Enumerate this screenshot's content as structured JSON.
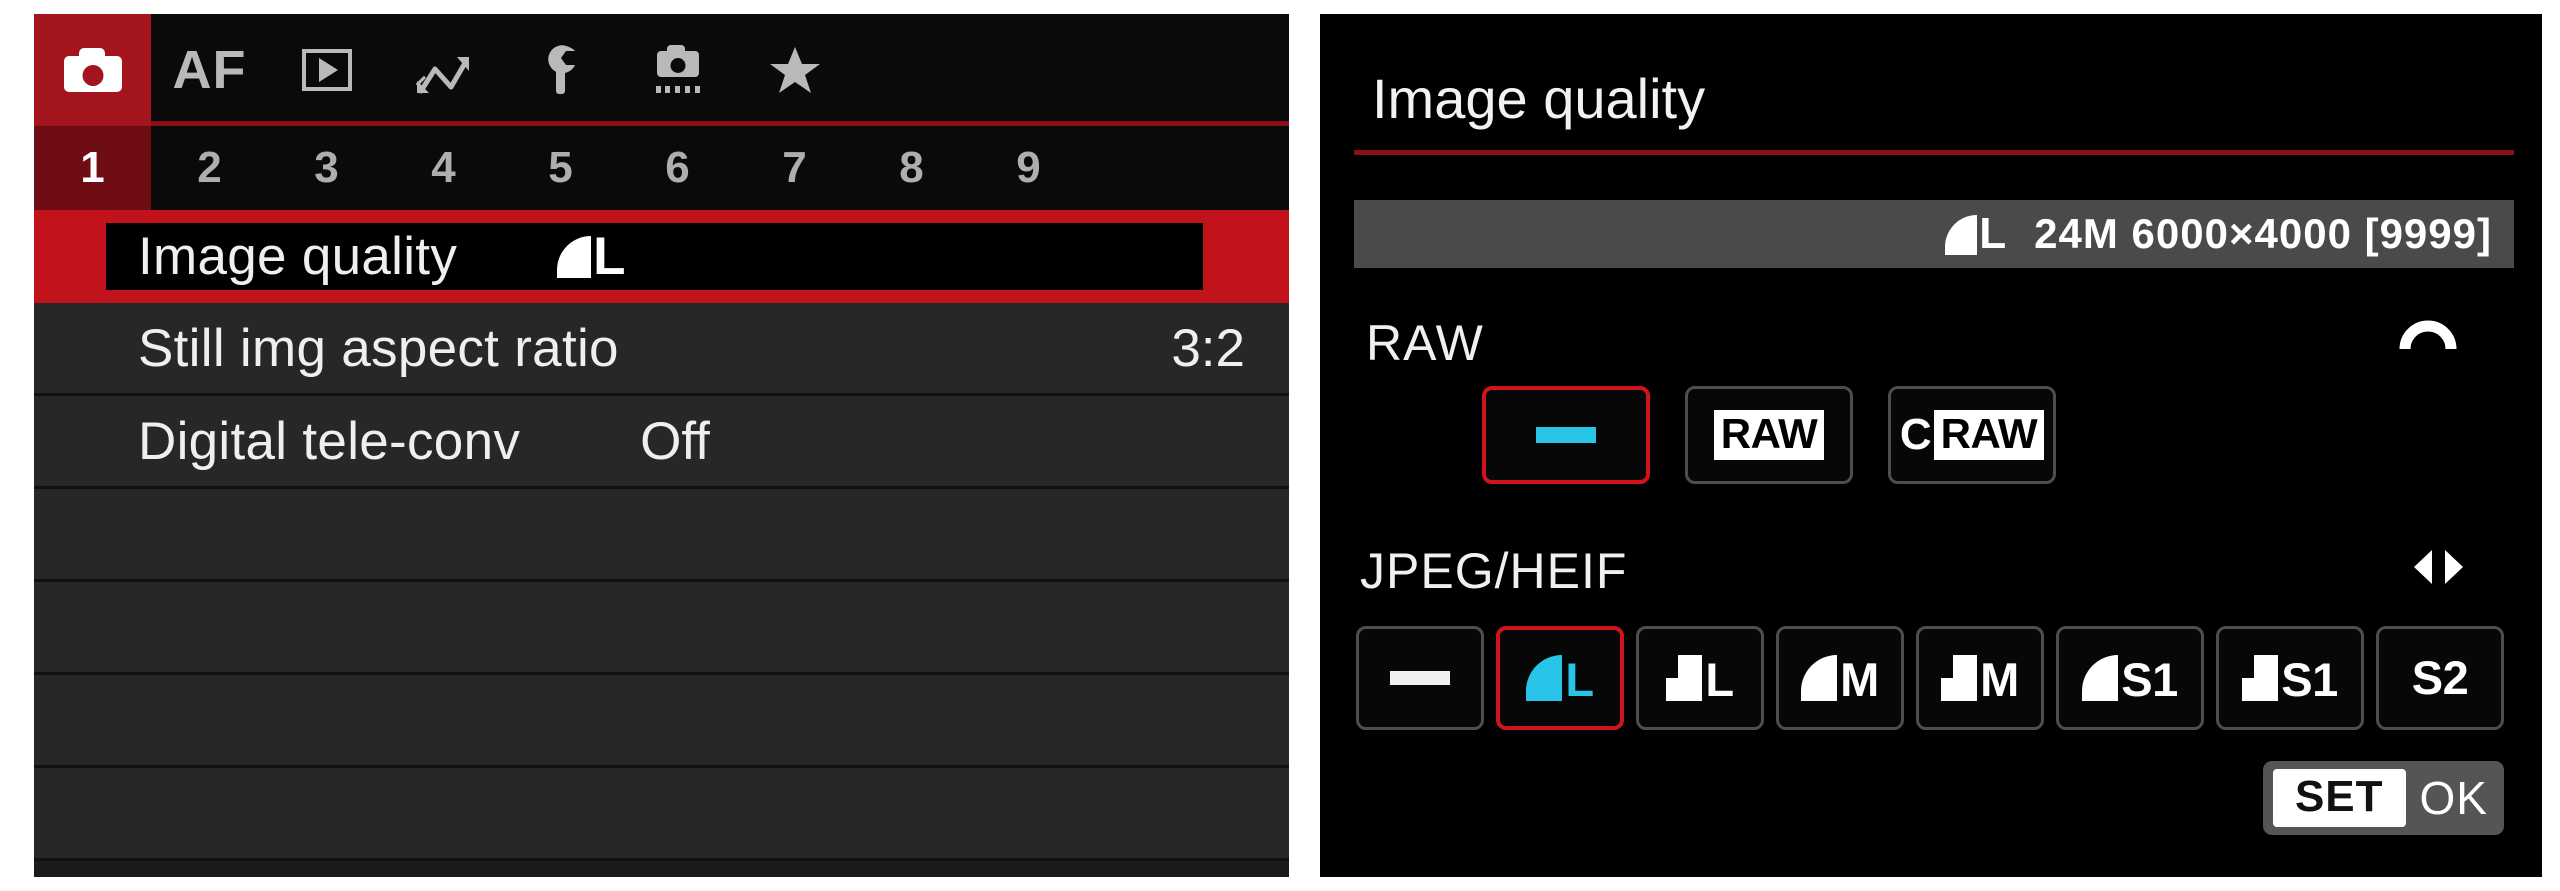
{
  "left_menu": {
    "tabs": [
      {
        "id": "shooting",
        "icon": "camera-icon",
        "label": "",
        "active": true
      },
      {
        "id": "af",
        "icon": "af-text",
        "label": "AF",
        "active": false
      },
      {
        "id": "playback",
        "icon": "play-icon",
        "label": "",
        "active": false
      },
      {
        "id": "wireless",
        "icon": "zigzag-icon",
        "label": "",
        "active": false
      },
      {
        "id": "setup",
        "icon": "wrench-icon",
        "label": "",
        "active": false
      },
      {
        "id": "custom",
        "icon": "custom-camera-icon",
        "label": "",
        "active": false
      },
      {
        "id": "myMenu",
        "icon": "star-icon",
        "label": "",
        "active": false
      }
    ],
    "pages": [
      "1",
      "2",
      "3",
      "4",
      "5",
      "6",
      "7",
      "8",
      "9"
    ],
    "active_page": "1",
    "items": [
      {
        "label": "Image quality",
        "value": "",
        "value_glyph": "fine-L",
        "value_text": "L",
        "selected": true
      },
      {
        "label": "Still img aspect ratio",
        "value": "3:2",
        "selected": false
      },
      {
        "label": "Digital tele-conv",
        "value": "Off",
        "selected": false
      },
      {
        "label": "",
        "value": "",
        "selected": false
      },
      {
        "label": "",
        "value": "",
        "selected": false
      },
      {
        "label": "",
        "value": "",
        "selected": false
      },
      {
        "label": "",
        "value": "",
        "selected": false
      }
    ]
  },
  "dialog": {
    "title": "Image quality",
    "info_bar": {
      "quality_glyph": "fine-L",
      "quality_label": "L",
      "spec": "24M 6000×4000 [9999]"
    },
    "raw": {
      "label": "RAW",
      "hint_icon": "main-dial-icon",
      "options": [
        {
          "id": "none",
          "type": "dash",
          "text": "",
          "selected": true
        },
        {
          "id": "raw",
          "type": "badge",
          "text": "RAW",
          "selected": false
        },
        {
          "id": "craw",
          "type": "badge-c",
          "prefix": "C",
          "text": "RAW",
          "selected": false
        }
      ]
    },
    "jpeg": {
      "label": "JPEG/HEIF",
      "hint_icon": "left-right-arrows-icon",
      "options": [
        {
          "id": "none",
          "type": "dash",
          "glyph": "",
          "text": "",
          "selected": false
        },
        {
          "id": "fine-L",
          "type": "quality",
          "glyph": "fine",
          "text": "L",
          "selected": true
        },
        {
          "id": "norm-L",
          "type": "quality",
          "glyph": "normal",
          "text": "L",
          "selected": false
        },
        {
          "id": "fine-M",
          "type": "quality",
          "glyph": "fine",
          "text": "M",
          "selected": false
        },
        {
          "id": "norm-M",
          "type": "quality",
          "glyph": "normal",
          "text": "M",
          "selected": false
        },
        {
          "id": "fine-S1",
          "type": "quality",
          "glyph": "fine",
          "text": "S1",
          "selected": false
        },
        {
          "id": "norm-S1",
          "type": "quality",
          "glyph": "normal",
          "text": "S1",
          "selected": false
        },
        {
          "id": "S2",
          "type": "text",
          "glyph": "",
          "text": "S2",
          "selected": false
        }
      ]
    },
    "confirm": {
      "set_label": "SET",
      "ok_label": "OK"
    }
  },
  "colors": {
    "accent_red": "#c2121b",
    "tab_red": "#a4141c",
    "page_red": "#6d0c12",
    "rule_red": "#8d0f16",
    "cyan": "#29c5e8",
    "panel_bg": "#1b1b1b",
    "row_bg": "#272727",
    "info_bar_bg": "#4a4a4a"
  }
}
